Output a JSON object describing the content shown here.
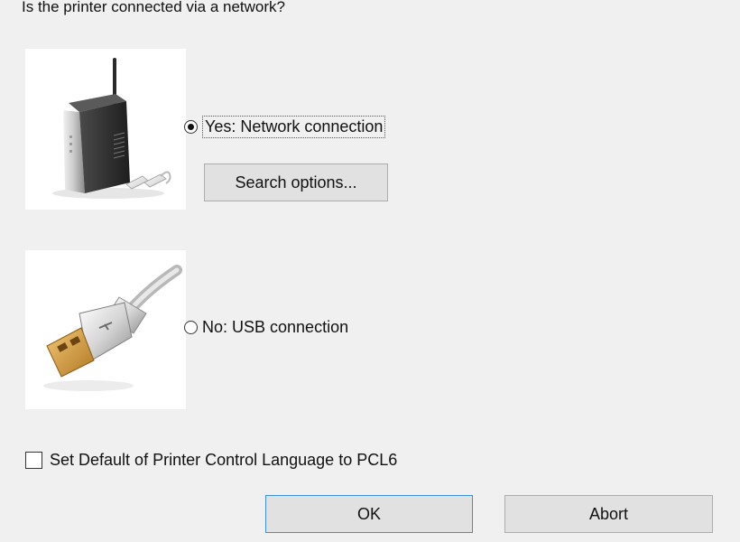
{
  "dialog": {
    "question": "Is the printer connected via a network?"
  },
  "options": {
    "network": {
      "label": "Yes: Network connection",
      "selected": true,
      "icon": "router-icon"
    },
    "usb": {
      "label": "No: USB connection",
      "selected": false,
      "icon": "usb-plug-icon"
    }
  },
  "buttons": {
    "search_options": "Search options...",
    "ok": "OK",
    "abort": "Abort"
  },
  "pcl6_checkbox": {
    "label": "Set Default of Printer Control Language to PCL6",
    "checked": false
  },
  "colors": {
    "background": "#f0f0f0",
    "button_face": "#e1e1e1",
    "default_button_border": "#3c8fd8"
  }
}
